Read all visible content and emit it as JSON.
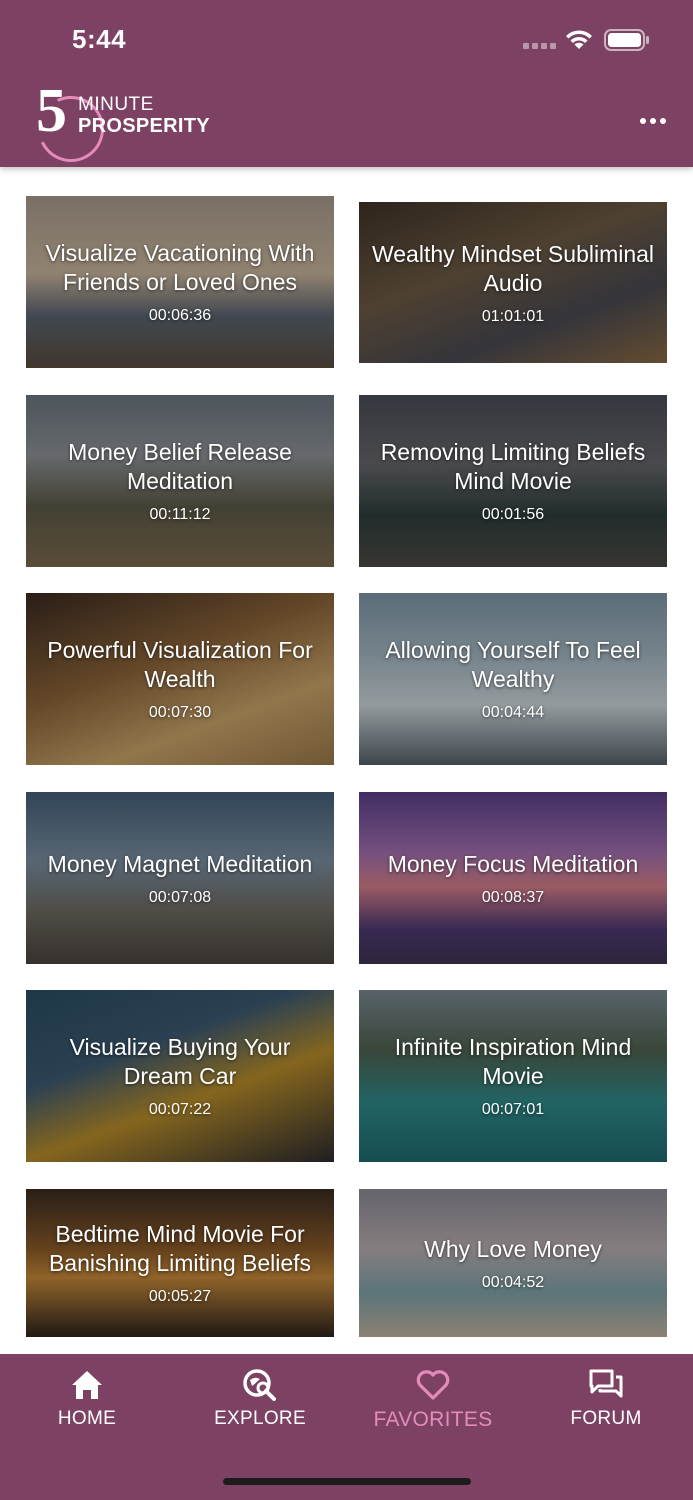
{
  "status_bar": {
    "time": "5:44"
  },
  "header": {
    "logo": {
      "digit": "5",
      "line1": "MINUTE",
      "line2": "PROSPERITY"
    },
    "menu_icon": "more-horizontal-icon"
  },
  "cards": [
    {
      "title": "Visualize Vacationing With Friends or Loved Ones",
      "duration": "00:06:36"
    },
    {
      "title": "Wealthy Mindset Subliminal Audio",
      "duration": "01:01:01"
    },
    {
      "title": "Money Belief Release Meditation",
      "duration": "00:11:12"
    },
    {
      "title": "Removing Limiting Beliefs Mind Movie",
      "duration": "00:01:56"
    },
    {
      "title": "Powerful Visualization For Wealth",
      "duration": "00:07:30"
    },
    {
      "title": "Allowing Yourself To Feel Wealthy",
      "duration": "00:04:44"
    },
    {
      "title": "Money Magnet Meditation",
      "duration": "00:07:08"
    },
    {
      "title": "Money Focus Meditation",
      "duration": "00:08:37"
    },
    {
      "title": "Visualize Buying Your Dream Car",
      "duration": "00:07:22"
    },
    {
      "title": "Infinite Inspiration Mind Movie",
      "duration": "00:07:01"
    },
    {
      "title": "Bedtime Mind Movie For Banishing Limiting Beliefs",
      "duration": "00:05:27"
    },
    {
      "title": "Why Love Money",
      "duration": "00:04:52"
    }
  ],
  "bottom_nav": {
    "items": [
      {
        "label": "HOME",
        "icon": "home-icon"
      },
      {
        "label": "EXPLORE",
        "icon": "explore-icon"
      },
      {
        "label": "FAVORITES",
        "icon": "heart-icon"
      },
      {
        "label": "FORUM",
        "icon": "forum-icon"
      }
    ],
    "active": "FAVORITES"
  },
  "colors": {
    "brand": "#7d4263",
    "accent": "#e58bbb",
    "text_on_brand": "#ffffff"
  }
}
